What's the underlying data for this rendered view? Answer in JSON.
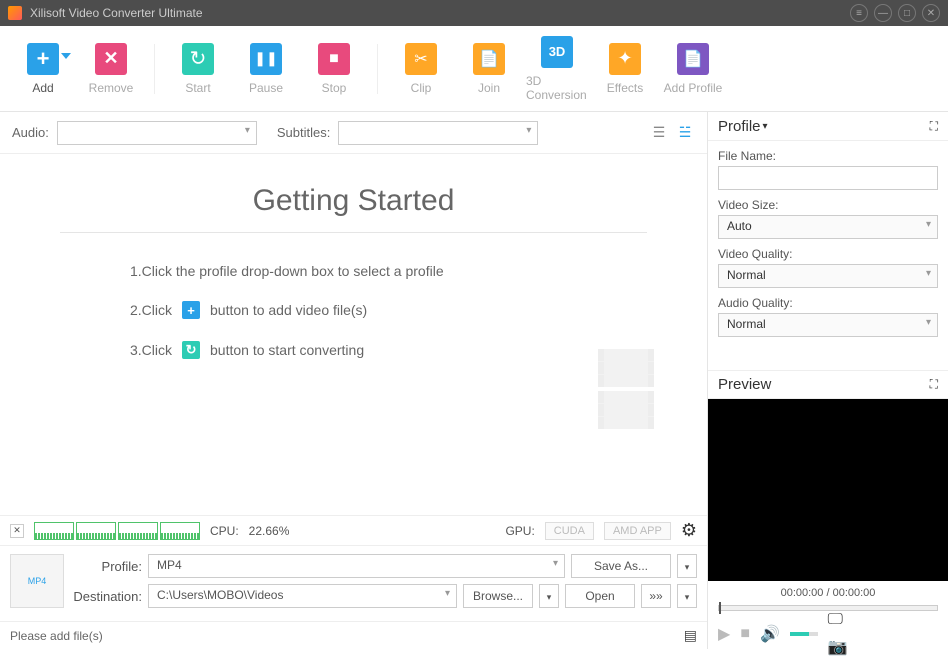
{
  "title": "Xilisoft Video Converter Ultimate",
  "toolbar": {
    "add": "Add",
    "remove": "Remove",
    "start": "Start",
    "pause": "Pause",
    "stop": "Stop",
    "clip": "Clip",
    "join": "Join",
    "conv3d": "3D Conversion",
    "effects": "Effects",
    "addprofile": "Add Profile",
    "three_d": "3D"
  },
  "subbar": {
    "audio_label": "Audio:",
    "subtitles_label": "Subtitles:"
  },
  "gs": {
    "heading": "Getting Started",
    "step1": "1.Click the profile drop-down box to select a profile",
    "step2a": "2.Click",
    "step2b": "button to add video file(s)",
    "step3a": "3.Click",
    "step3b": "button to start converting"
  },
  "cpu": {
    "label": "CPU:",
    "value": "22.66%",
    "gpu_label": "GPU:",
    "cuda": "CUDA",
    "amd": "AMD APP"
  },
  "out": {
    "profile_label": "Profile:",
    "profile_value": "MP4",
    "dest_label": "Destination:",
    "dest_value": "C:\\Users\\MOBO\\Videos",
    "saveas": "Save As...",
    "browse": "Browse...",
    "open": "Open",
    "queue": "»»",
    "thumb_badge": "MP4"
  },
  "status": {
    "msg": "Please add file(s)"
  },
  "profile_panel": {
    "heading": "Profile",
    "filename_label": "File Name:",
    "filename_value": "",
    "videosize_label": "Video Size:",
    "videosize_value": "Auto",
    "vquality_label": "Video Quality:",
    "vquality_value": "Normal",
    "aquality_label": "Audio Quality:",
    "aquality_value": "Normal"
  },
  "preview": {
    "heading": "Preview",
    "time": "00:00:00 / 00:00:00"
  }
}
